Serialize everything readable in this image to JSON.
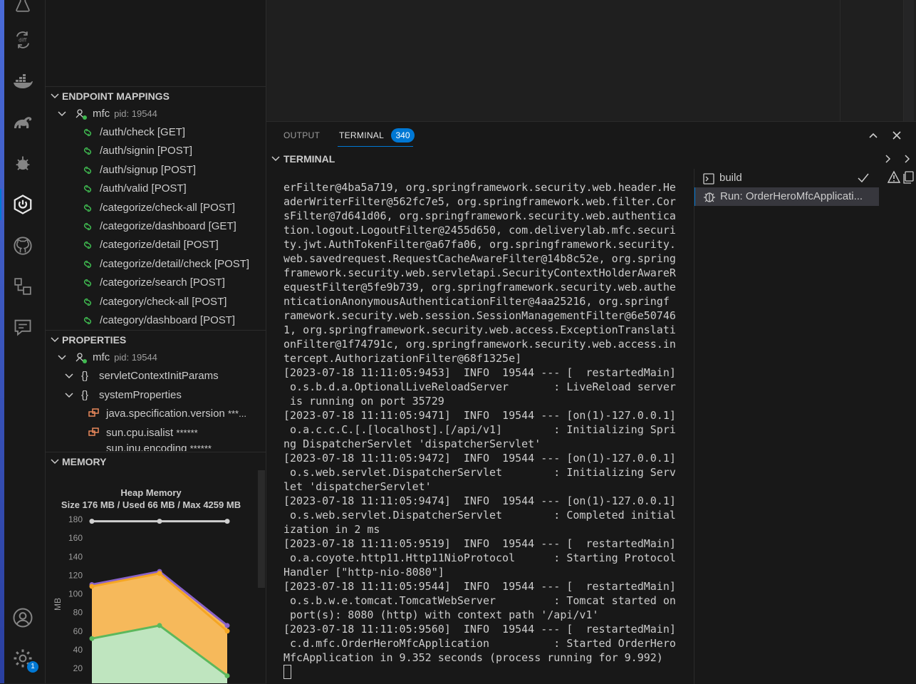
{
  "sidebar": {
    "endpoint_header": "ENDPOINT MAPPINGS",
    "endpoint_app": {
      "name": "mfc",
      "pid": "pid: 19544"
    },
    "endpoints": [
      "/auth/check [GET]",
      "/auth/signin [POST]",
      "/auth/signup [POST]",
      "/auth/valid [POST]",
      "/categorize/check-all [POST]",
      "/categorize/dashboard [GET]",
      "/categorize/detail [POST]",
      "/categorize/detail/check [POST]",
      "/categorize/search [POST]",
      "/category/check-all [POST]",
      "/category/dashboard [POST]"
    ],
    "properties_header": "PROPERTIES",
    "properties_app": {
      "name": "mfc",
      "pid": "pid: 19544"
    },
    "property_groups": [
      "servletContextInitParams",
      "systemProperties"
    ],
    "property_items": [
      {
        "name": "java.specification.version",
        "value": "***..."
      },
      {
        "name": "sun.cpu.isalist",
        "value": "******"
      },
      {
        "name": "sun.jnu.encoding",
        "value": "******"
      }
    ],
    "memory_header": "MEMORY"
  },
  "activity": {
    "icons": [
      "testing-icon",
      "diff-icon",
      "docker-icon",
      "gradle-icon",
      "debug-icon",
      "spring-boot-icon",
      "github-icon",
      "remote-explorer-icon",
      "comments-icon",
      "account-icon",
      "settings-icon"
    ],
    "settings_badge": "1"
  },
  "chart_data": {
    "type": "area",
    "title": "Heap Memory",
    "subtitle": "Size 176 MB / Used 66 MB / Max 4259 MB",
    "ylabel": "MB",
    "xlabel": "",
    "ylim": [
      20,
      180
    ],
    "yticks": [
      180,
      160,
      140,
      120,
      100,
      80,
      60,
      40,
      20
    ],
    "series": [
      {
        "color": "#ffffff",
        "values": [
          178,
          178,
          178
        ]
      },
      {
        "color": "#8a63c9",
        "values": [
          110,
          124,
          66
        ]
      },
      {
        "color": "#f5a623",
        "values": [
          108,
          122,
          60
        ]
      },
      {
        "color": "#5cb85c",
        "values": [
          52,
          66,
          12
        ]
      }
    ]
  },
  "panel": {
    "tabs": [
      "OUTPUT",
      "TERMINAL"
    ],
    "terminal_badge": "340",
    "section_title": "TERMINAL",
    "terminals": [
      "build",
      "Run: OrderHeroMfcApplicati..."
    ],
    "lines": [
      "erFilter@4ba5a719, org.springframework.security.web.header.He",
      "aderWriterFilter@562fc7e5, org.springframework.web.filter.Cor",
      "sFilter@7d641d06, org.springframework.security.web.authentica",
      "tion.logout.LogoutFilter@2455d650, com.deliverylab.mfc.securi",
      "ty.jwt.AuthTokenFilter@a67fa06, org.springframework.security.",
      "web.savedrequest.RequestCacheAwareFilter@14b8c52e, org.spring",
      "framework.security.web.servletapi.SecurityContextHolderAwareR",
      "equestFilter@5fe9b739, org.springframework.security.web.authe",
      "nticationAnonymousAuthenticationFilter@4aa25216, org.springf",
      "ramework.security.web.session.SessionManagementFilter@6e50746",
      "1, org.springframework.security.web.access.ExceptionTranslati",
      "onFilter@1f74791c, org.springframework.security.web.access.in",
      "tercept.AuthorizationFilter@68f1325e]",
      "[2023-07-18 11:11:05:9453]  INFO  19544 --- [  restartedMain]",
      " o.s.b.d.a.OptionalLiveReloadServer       : LiveReload server",
      " is running on port 35729",
      "[2023-07-18 11:11:05:9471]  INFO  19544 --- [on(1)-127.0.0.1]",
      " o.a.c.c.C.[.[localhost].[/api/v1]        : Initializing Spri",
      "ng DispatcherServlet 'dispatcherServlet'",
      "[2023-07-18 11:11:05:9472]  INFO  19544 --- [on(1)-127.0.0.1]",
      " o.s.web.servlet.DispatcherServlet        : Initializing Serv",
      "let 'dispatcherServlet'",
      "[2023-07-18 11:11:05:9474]  INFO  19544 --- [on(1)-127.0.0.1]",
      " o.s.web.servlet.DispatcherServlet        : Completed initial",
      "ization in 2 ms",
      "[2023-07-18 11:11:05:9519]  INFO  19544 --- [  restartedMain]",
      " o.a.coyote.http11.Http11NioProtocol      : Starting Protocol",
      "Handler [\"http-nio-8080\"]",
      "[2023-07-18 11:11:05:9544]  INFO  19544 --- [  restartedMain]",
      " o.s.b.w.e.tomcat.TomcatWebServer         : Tomcat started on",
      " port(s): 8080 (http) with context path '/api/v1'",
      "[2023-07-18 11:11:05:9560]  INFO  19544 --- [  restartedMain]",
      " c.d.mfc.OrderHeroMfcApplication          : Started OrderHero",
      "MfcApplication in 9.352 seconds (process running for 9.992)"
    ]
  }
}
